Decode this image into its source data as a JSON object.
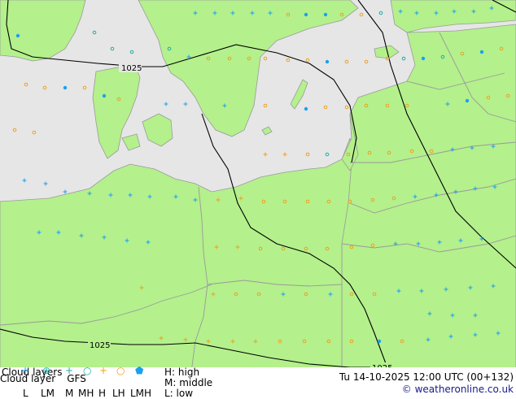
{
  "map": {
    "colors": {
      "land": "#b4f08c",
      "sea": "#e6e6e6",
      "border": "#9a9a9a",
      "isobar": "#000000",
      "low": "#1aa0f0",
      "middle": "#22aaaa",
      "high": "#f0a020"
    },
    "isobar_labels": [
      {
        "text": "1025"
      },
      {
        "text": "1025"
      },
      {
        "text": "1025"
      }
    ]
  },
  "legend": {
    "title": "Cloud layers",
    "subtitle": "Cloud layer",
    "model": "GFS",
    "h_key": "H: high",
    "m_key": "M: middle",
    "l_key": "L: low",
    "symbols": [
      "L",
      "LM",
      "M",
      "MH",
      "H",
      "LH",
      "LMH"
    ],
    "symbol_icons": [
      "plus-icon",
      "circle-plus-icon",
      "plus-icon",
      "circle-icon",
      "plus-icon",
      "circle-icon",
      "dot-icon"
    ],
    "datetime": "Tu 14-10-2025 12:00 UTC (00+132)",
    "copyright": "© weatheronline.co.uk"
  }
}
